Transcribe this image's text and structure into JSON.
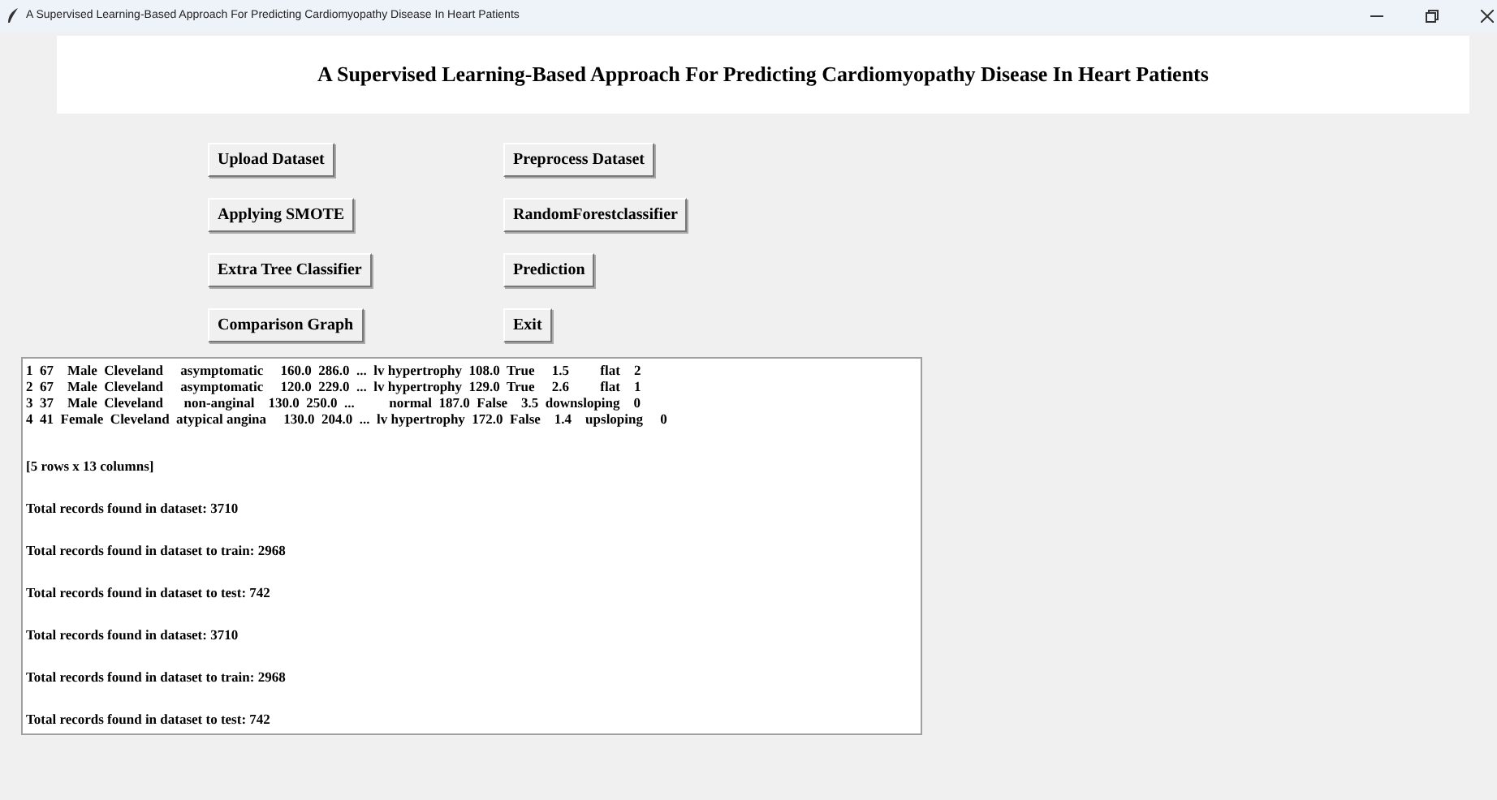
{
  "window": {
    "title": "A Supervised Learning-Based Approach For Predicting Cardiomyopathy Disease In Heart Patients"
  },
  "header": {
    "title": "A Supervised Learning-Based Approach For Predicting Cardiomyopathy Disease In Heart Patients"
  },
  "buttons": [
    {
      "label": "Upload Dataset"
    },
    {
      "label": "Preprocess Dataset"
    },
    {
      "label": "Applying SMOTE"
    },
    {
      "label": "RandomForestclassifier"
    },
    {
      "label": "Extra Tree Classifier"
    },
    {
      "label": "Prediction"
    },
    {
      "label": "Comparison Graph"
    },
    {
      "label": "Exit"
    }
  ],
  "output": {
    "lines": [
      {
        "kind": "row",
        "text": "1  67    Male  Cleveland     asymptomatic     160.0  286.0  ...  lv hypertrophy  108.0  True     1.5         flat    2"
      },
      {
        "kind": "row",
        "text": "2  67    Male  Cleveland     asymptomatic     120.0  229.0  ...  lv hypertrophy  129.0  True     2.6         flat    1"
      },
      {
        "kind": "row",
        "text": "3  37    Male  Cleveland      non-anginal    130.0  250.0  ...          normal  187.0  False    3.5  downsloping    0"
      },
      {
        "kind": "row",
        "text": "4  41  Female  Cleveland  atypical angina     130.0  204.0  ...  lv hypertrophy  172.0  False    1.4    upsloping     0"
      },
      {
        "kind": "message",
        "text": "[5 rows x 13 columns]"
      },
      {
        "kind": "message",
        "text": "Total records found in dataset: 3710"
      },
      {
        "kind": "message",
        "text": "Total records found in dataset to train: 2968"
      },
      {
        "kind": "message",
        "text": "Total records found in dataset to test: 742"
      },
      {
        "kind": "message",
        "text": "Total records found in dataset: 3710"
      },
      {
        "kind": "message",
        "text": "Total records found in dataset to train: 2968"
      },
      {
        "kind": "message",
        "text": "Total records found in dataset to test: 742"
      }
    ]
  }
}
